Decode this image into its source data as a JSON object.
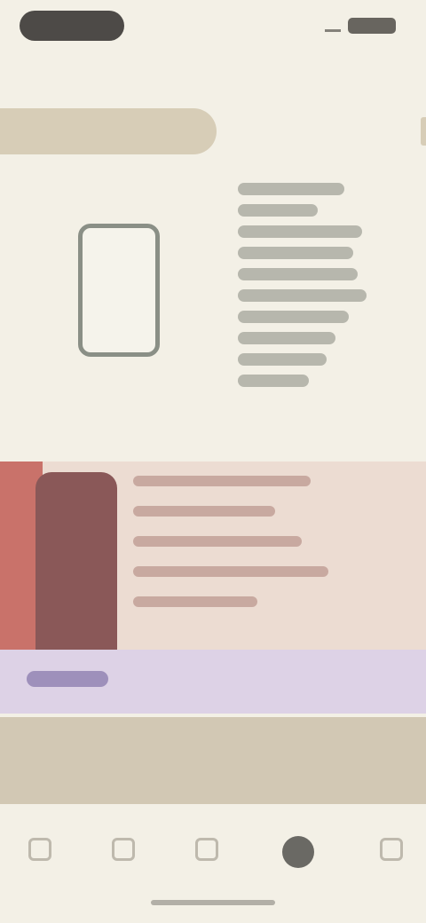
{
  "status_bar": {
    "time": "",
    "icons": [
      "signal-icon",
      "battery-icon"
    ]
  },
  "app": {
    "brand": ""
  },
  "tabs": [
    {
      "label": "",
      "active": true
    },
    {
      "label": "",
      "active": false
    }
  ],
  "purple": {
    "label": ""
  },
  "cta": {
    "label": ""
  },
  "bottom_nav": {
    "items": [
      {
        "icon": "nav-icon-1",
        "label": ""
      },
      {
        "icon": "nav-icon-2",
        "label": ""
      },
      {
        "icon": "nav-icon-3",
        "label": ""
      },
      {
        "icon": "avatar-icon",
        "label": ""
      },
      {
        "icon": "nav-icon-5",
        "label": ""
      }
    ]
  },
  "colors": {
    "background": "#f3f0e6",
    "tab_active": "#d7cdb7",
    "swatch_red": "#c9726a",
    "swatch_maroon": "#8a5858",
    "swatch_blush": "#ecdcd2",
    "purple_row": "#ddd2e6",
    "cta_bg": "#d2c8b4"
  }
}
